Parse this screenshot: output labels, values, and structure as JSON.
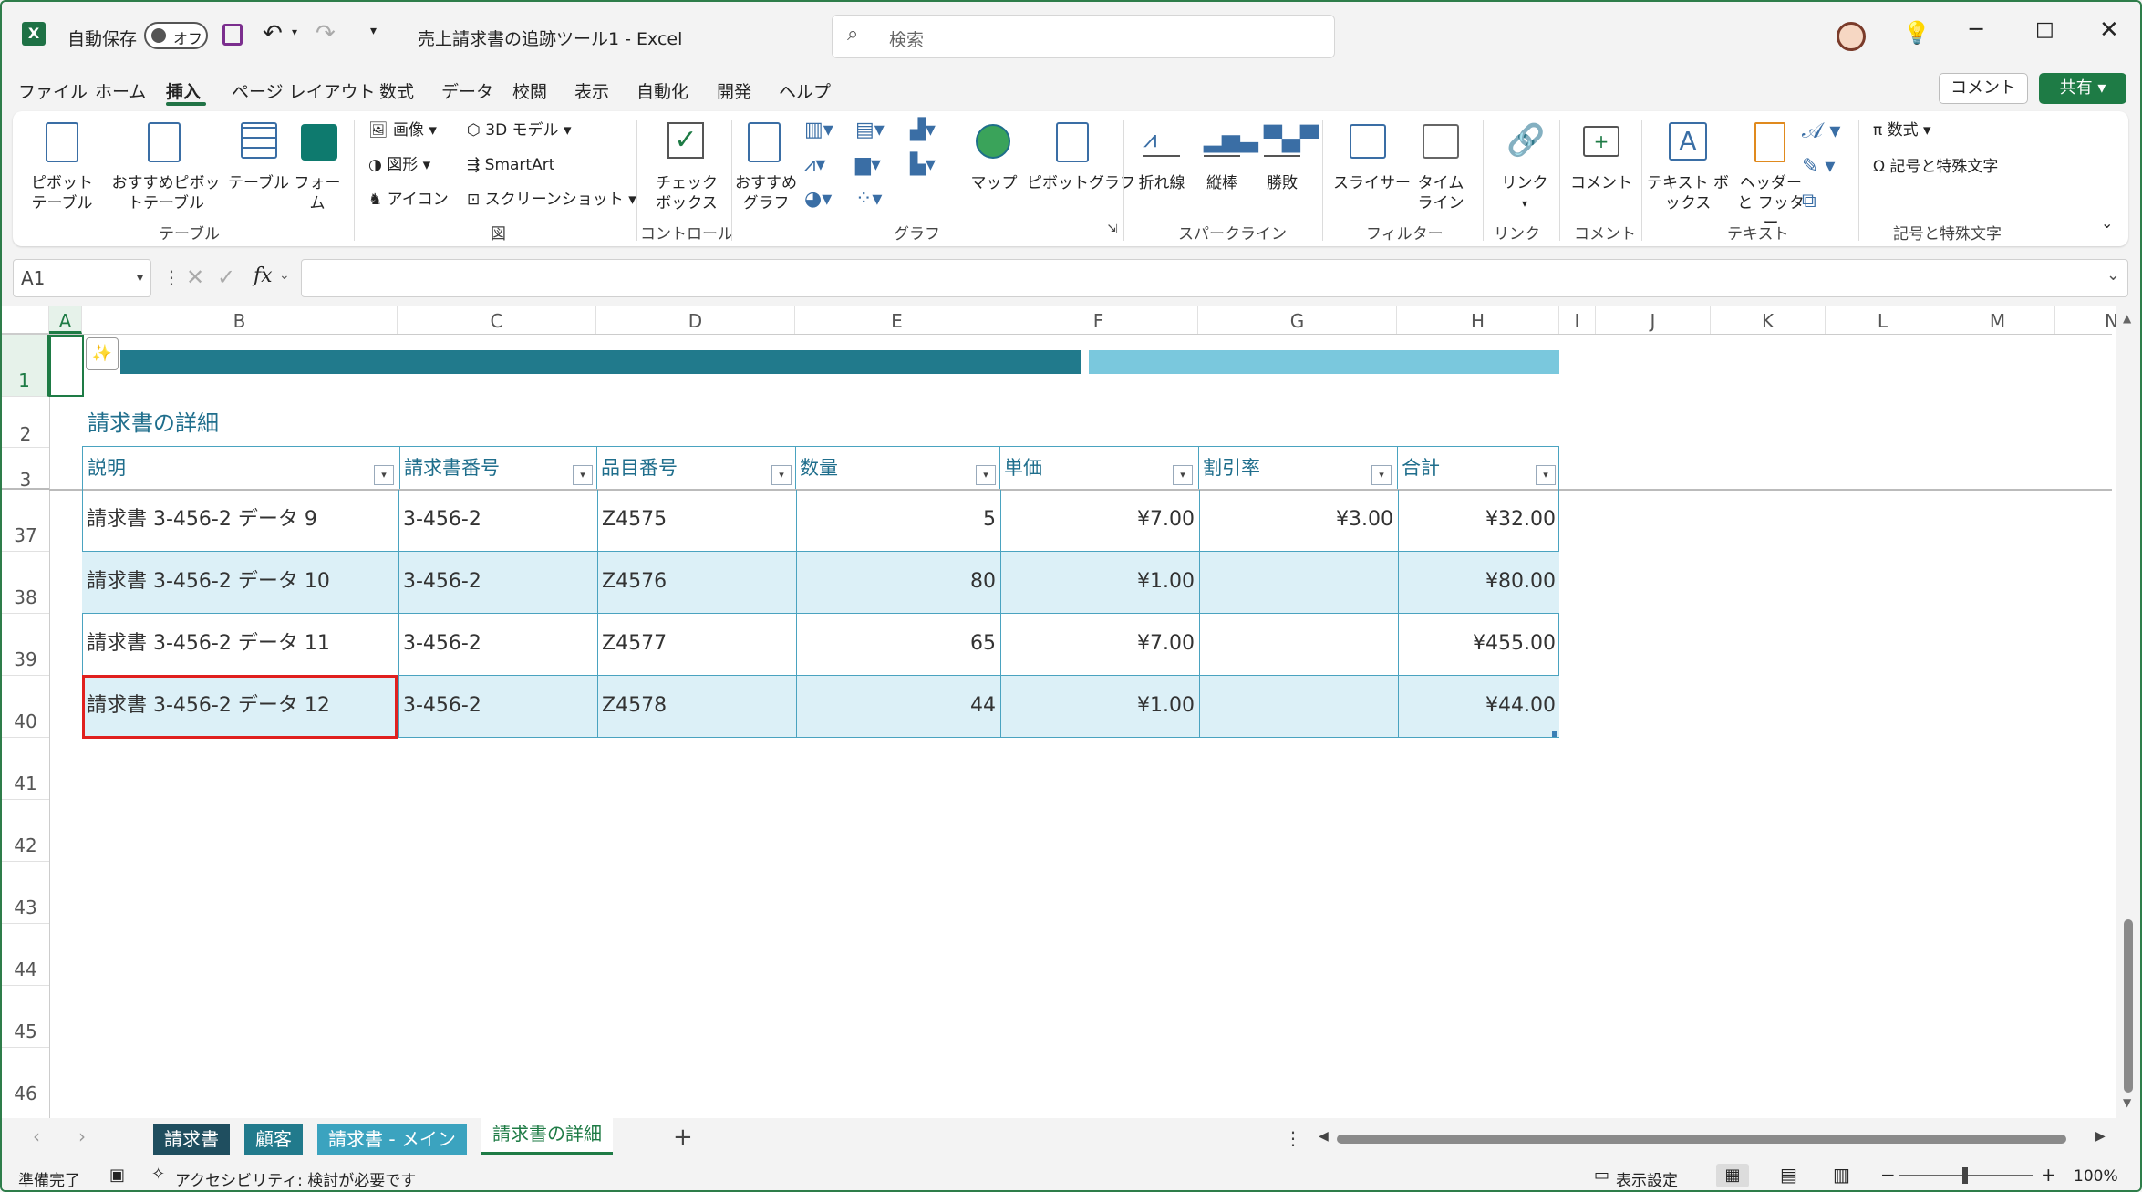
{
  "title_bar": {
    "autosave_label": "自動保存",
    "autosave_state": "オフ",
    "doc_title": "売上請求書の追跡ツール1 - Excel",
    "search_placeholder": "検索"
  },
  "menu": {
    "items": [
      "ファイル",
      "ホーム",
      "挿入",
      "ページ レイアウト",
      "数式",
      "データ",
      "校閲",
      "表示",
      "自動化",
      "開発",
      "ヘルプ"
    ],
    "active": "挿入",
    "comment_btn": "コメント",
    "share_btn": "共有"
  },
  "ribbon": {
    "pivot": "ピボットテーブル",
    "recommended_pivot": "おすすめピボットテーブル",
    "table": "テーブル",
    "forms": "フォーム",
    "image": "画像",
    "shapes": "図形",
    "icons": "アイコン",
    "model3d": "3D モデル",
    "smartart": "SmartArt",
    "screenshot": "スクリーンショット",
    "checkbox": "チェック ボックス",
    "rec_chart": "おすすめ グラフ",
    "map": "マップ",
    "pivot_chart": "ピボットグラフ",
    "line": "折れ線",
    "column": "縦棒",
    "winloss": "勝敗",
    "slicer": "スライサー",
    "timeline": "タイム ライン",
    "link": "リンク",
    "comment": "コメント",
    "textbox": "テキスト ボックス",
    "header_footer": "ヘッダーと フッター",
    "equation": "数式",
    "symbol": "記号と特殊文字",
    "groups": {
      "table": "テーブル",
      "illust": "図",
      "controls": "コントロール",
      "charts": "グラフ",
      "sparklines": "スパークライン",
      "filters": "フィルター",
      "links": "リンク",
      "comments": "コメント",
      "text": "テキスト",
      "symbols": "記号と特殊文字"
    }
  },
  "formula_bar": {
    "name_box": "A1",
    "fx": "fx",
    "formula": ""
  },
  "columns": [
    "A",
    "B",
    "C",
    "D",
    "E",
    "F",
    "G",
    "H",
    "I",
    "J",
    "K",
    "L",
    "M",
    "N"
  ],
  "rows": [
    "1",
    "2",
    "3",
    "37",
    "38",
    "39",
    "40",
    "41",
    "42",
    "43",
    "44",
    "45",
    "46"
  ],
  "sheet": {
    "section_title": "請求書の詳細",
    "headers": [
      "説明",
      "請求書番号",
      "品目番号",
      "数量",
      "単価",
      "割引率",
      "合計"
    ],
    "data": [
      [
        "請求書 3-456-2 データ 9",
        "3-456-2",
        "Z4575",
        "5",
        "¥7.00",
        "¥3.00",
        "¥32.00"
      ],
      [
        "請求書 3-456-2 データ 10",
        "3-456-2",
        "Z4576",
        "80",
        "¥1.00",
        "",
        "¥80.00"
      ],
      [
        "請求書 3-456-2 データ 11",
        "3-456-2",
        "Z4577",
        "65",
        "¥7.00",
        "",
        "¥455.00"
      ],
      [
        "請求書 3-456-2 データ 12",
        "3-456-2",
        "Z4578",
        "44",
        "¥1.00",
        "",
        "¥44.00"
      ]
    ],
    "colors": {
      "dark_teal": "#217a8c",
      "light_teal": "#7ac8dd",
      "band": "#dcf0f7",
      "selection": "#e0201e"
    }
  },
  "tabs": [
    {
      "label": "請求書",
      "color": "#1f4e5f"
    },
    {
      "label": "顧客",
      "color": "#217a8c"
    },
    {
      "label": "請求書 - メイン",
      "color": "#3ba3bf"
    },
    {
      "label": "請求書の詳細",
      "color": ""
    }
  ],
  "status": {
    "ready": "準備完了",
    "accessibility": "アクセシビリティ: 検討が必要です",
    "display_settings": "表示設定",
    "zoom": "100%"
  }
}
